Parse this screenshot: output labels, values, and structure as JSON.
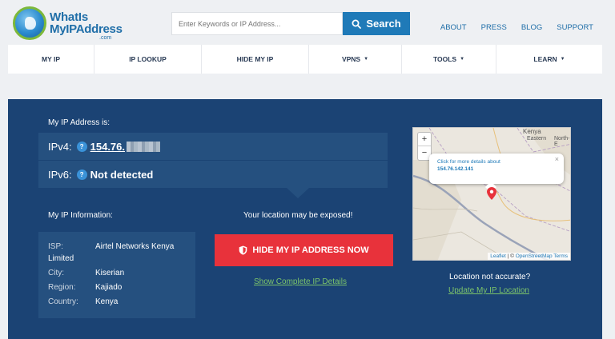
{
  "logo": {
    "line1": "WhatIs",
    "line2": "MyIPAddress",
    "line3": ".com"
  },
  "search": {
    "placeholder": "Enter Keywords or IP Address...",
    "button_label": "Search"
  },
  "toplinks": [
    "ABOUT",
    "PRESS",
    "BLOG",
    "SUPPORT"
  ],
  "nav": [
    {
      "label": "MY IP",
      "dropdown": false
    },
    {
      "label": "IP LOOKUP",
      "dropdown": false
    },
    {
      "label": "HIDE MY IP",
      "dropdown": false
    },
    {
      "label": "VPNS",
      "dropdown": true
    },
    {
      "label": "TOOLS",
      "dropdown": true
    },
    {
      "label": "LEARN",
      "dropdown": true
    }
  ],
  "ip": {
    "heading": "My IP Address is:",
    "ipv4_label": "IPv4:",
    "ipv4_value": "154.76.",
    "ipv6_label": "IPv6:",
    "ipv6_value": "Not detected",
    "help_glyph": "?"
  },
  "info": {
    "heading": "My IP Information:",
    "isp_label": "ISP:",
    "isp_value": "Airtel Networks Kenya",
    "isp_cont": "Limited",
    "city_label": "City:",
    "city_value": "Kiserian",
    "region_label": "Region:",
    "region_value": "Kajiado",
    "country_label": "Country:",
    "country_value": "Kenya"
  },
  "cta": {
    "exposed": "Your location may be exposed!",
    "hide_button": "HIDE MY IP ADDRESS NOW",
    "show_details": "Show Complete IP Details"
  },
  "map": {
    "zoom_in": "+",
    "zoom_out": "−",
    "label_kenya": "Kenya",
    "label_eastern": "Eastern",
    "label_north": "North-E",
    "popup_line1": "Click for more details about",
    "popup_ip": "154.76.142.141",
    "popup_close": "×",
    "attr_leaflet": "Leaflet",
    "attr_sep": " | © ",
    "attr_osm": "OpenStreetMap",
    "attr_terms": "Terms"
  },
  "location": {
    "not_accurate": "Location not accurate?",
    "update_link": "Update My IP Location"
  },
  "colors": {
    "panel": "#1b4374",
    "accent_blue": "#1f7ab8",
    "cta_red": "#e8323b",
    "link_green": "#7cc46a"
  }
}
